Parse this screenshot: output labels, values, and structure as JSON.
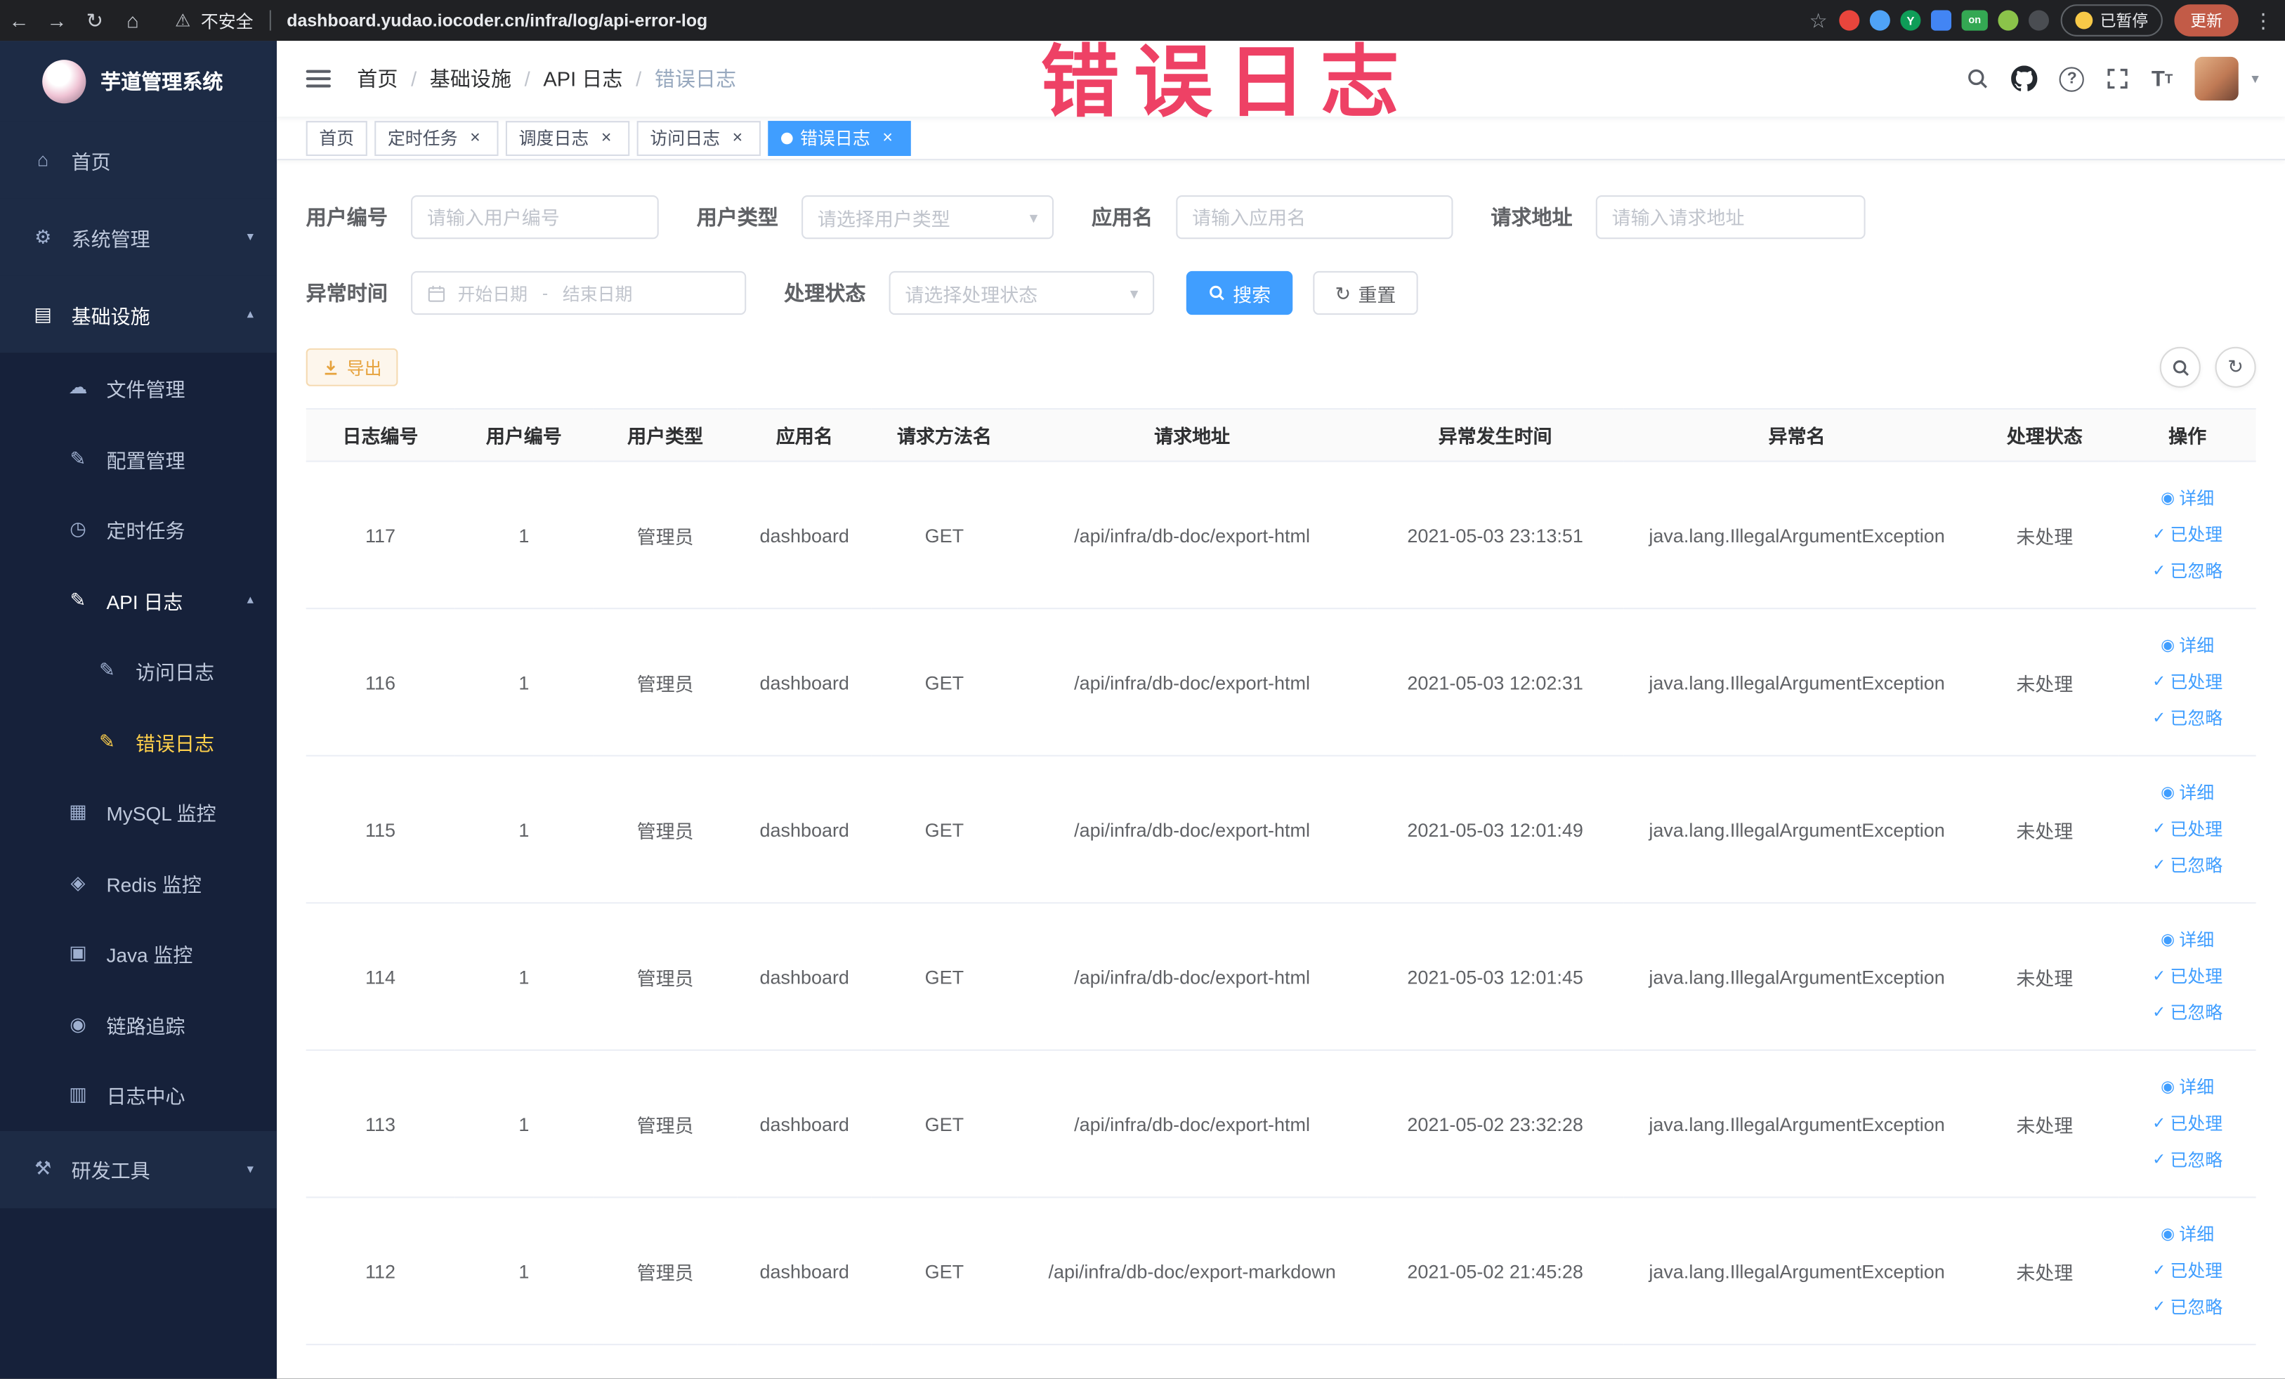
{
  "browser": {
    "security_label": "不安全",
    "url": "dashboard.yudao.iocoder.cn/infra/log/api-error-log",
    "paused_badge": "已暂停",
    "update_button": "更新",
    "extensions": [
      {
        "key": "red-circle",
        "label": ""
      },
      {
        "key": "blue-drop",
        "label": ""
      },
      {
        "key": "green-y",
        "label": "Y"
      },
      {
        "key": "blue-grid",
        "label": ""
      },
      {
        "key": "green-on",
        "label": "on"
      },
      {
        "key": "leaf",
        "label": ""
      },
      {
        "key": "paw",
        "label": ""
      }
    ]
  },
  "annotation": {
    "text": "错误日志"
  },
  "sidebar": {
    "logo_title": "芋道管理系统",
    "items": [
      {
        "key": "home",
        "label": "首页",
        "icon": "home",
        "level": 1
      },
      {
        "key": "system",
        "label": "系统管理",
        "icon": "gear",
        "level": 1,
        "chevron": "down"
      },
      {
        "key": "infra",
        "label": "基础设施",
        "icon": "infra",
        "level": 1,
        "chevron": "up",
        "open": true
      },
      {
        "key": "file",
        "label": "文件管理",
        "icon": "cloud",
        "level": 2
      },
      {
        "key": "config",
        "label": "配置管理",
        "icon": "edit",
        "level": 2
      },
      {
        "key": "job",
        "label": "定时任务",
        "icon": "clock",
        "level": 2
      },
      {
        "key": "api-log",
        "label": "API 日志",
        "icon": "doc",
        "level": 2,
        "chevron": "up",
        "open": true
      },
      {
        "key": "access-log",
        "label": "访问日志",
        "icon": "doc",
        "level": 3
      },
      {
        "key": "error-log",
        "label": "错误日志",
        "icon": "doc",
        "level": 3,
        "active": true
      },
      {
        "key": "mysql",
        "label": "MySQL 监控",
        "icon": "db",
        "level": 2
      },
      {
        "key": "redis",
        "label": "Redis 监控",
        "icon": "redis",
        "level": 2
      },
      {
        "key": "java",
        "label": "Java 监控",
        "icon": "monitor",
        "level": 2
      },
      {
        "key": "trace",
        "label": "链路追踪",
        "icon": "trace",
        "level": 2
      },
      {
        "key": "log-center",
        "label": "日志中心",
        "icon": "logcenter",
        "level": 2
      },
      {
        "key": "dev-tools",
        "label": "研发工具",
        "icon": "tools",
        "level": 1,
        "chevron": "down"
      }
    ]
  },
  "breadcrumb": {
    "items": [
      "首页",
      "基础设施",
      "API 日志",
      "错误日志"
    ]
  },
  "tabs": [
    {
      "key": "home",
      "label": "首页",
      "closable": false,
      "active": false
    },
    {
      "key": "job",
      "label": "定时任务",
      "closable": true,
      "active": false
    },
    {
      "key": "job-log",
      "label": "调度日志",
      "closable": true,
      "active": false
    },
    {
      "key": "access-log",
      "label": "访问日志",
      "closable": true,
      "active": false
    },
    {
      "key": "error-log",
      "label": "错误日志",
      "closable": true,
      "active": true
    }
  ],
  "filters": {
    "user_id": {
      "label": "用户编号",
      "placeholder": "请输入用户编号"
    },
    "user_type": {
      "label": "用户类型",
      "placeholder": "请选择用户类型"
    },
    "app_name": {
      "label": "应用名",
      "placeholder": "请输入应用名"
    },
    "request_url": {
      "label": "请求地址",
      "placeholder": "请输入请求地址"
    },
    "exception_time": {
      "label": "异常时间",
      "start_placeholder": "开始日期",
      "separator": "-",
      "end_placeholder": "结束日期"
    },
    "process_status": {
      "label": "处理状态",
      "placeholder": "请选择处理状态"
    },
    "search_label": "搜索",
    "reset_label": "重置"
  },
  "toolbar": {
    "export_label": "导出"
  },
  "table": {
    "columns": [
      "日志编号",
      "用户编号",
      "用户类型",
      "应用名",
      "请求方法名",
      "请求地址",
      "异常发生时间",
      "异常名",
      "处理状态",
      "操作"
    ],
    "actions": [
      {
        "key": "detail",
        "label": "详细",
        "icon": "eye"
      },
      {
        "key": "processed",
        "label": "已处理",
        "icon": "check"
      },
      {
        "key": "ignored",
        "label": "已忽略",
        "icon": "check"
      }
    ],
    "rows": [
      {
        "id": "117",
        "user_id": "1",
        "user_type": "管理员",
        "app": "dashboard",
        "method": "GET",
        "url": "/api/infra/db-doc/export-html",
        "time": "2021-05-03 23:13:51",
        "exception": "java.lang.IllegalArgumentException",
        "status": "未处理"
      },
      {
        "id": "116",
        "user_id": "1",
        "user_type": "管理员",
        "app": "dashboard",
        "method": "GET",
        "url": "/api/infra/db-doc/export-html",
        "time": "2021-05-03 12:02:31",
        "exception": "java.lang.IllegalArgumentException",
        "status": "未处理"
      },
      {
        "id": "115",
        "user_id": "1",
        "user_type": "管理员",
        "app": "dashboard",
        "method": "GET",
        "url": "/api/infra/db-doc/export-html",
        "time": "2021-05-03 12:01:49",
        "exception": "java.lang.IllegalArgumentException",
        "status": "未处理"
      },
      {
        "id": "114",
        "user_id": "1",
        "user_type": "管理员",
        "app": "dashboard",
        "method": "GET",
        "url": "/api/infra/db-doc/export-html",
        "time": "2021-05-03 12:01:45",
        "exception": "java.lang.IllegalArgumentException",
        "status": "未处理"
      },
      {
        "id": "113",
        "user_id": "1",
        "user_type": "管理员",
        "app": "dashboard",
        "method": "GET",
        "url": "/api/infra/db-doc/export-html",
        "time": "2021-05-02 23:32:28",
        "exception": "java.lang.IllegalArgumentException",
        "status": "未处理"
      },
      {
        "id": "112",
        "user_id": "1",
        "user_type": "管理员",
        "app": "dashboard",
        "method": "GET",
        "url": "/api/infra/db-doc/export-markdown",
        "time": "2021-05-02 21:45:28",
        "exception": "java.lang.IllegalArgumentException",
        "status": "未处理"
      }
    ]
  },
  "icons": {
    "back": "←",
    "forward": "→",
    "reload": "↻",
    "browser_home": "⌂",
    "warning": "⚠",
    "star": "☆",
    "menu_dots": "⋮",
    "chevron_down": "▾",
    "chevron_up": "▴",
    "caret_down": "▾",
    "refresh": "↻",
    "check": "✓",
    "eye": "◉",
    "home": "⌂",
    "gear": "⚙",
    "infra": "▤",
    "cloud": "☁",
    "edit": "✎",
    "clock": "◷",
    "doc": "✎",
    "db": "▦",
    "redis": "◈",
    "monitor": "▣",
    "trace": "◉",
    "logcenter": "▥",
    "tools": "⚒"
  },
  "colors": {
    "accent": "#409eff",
    "active_menu": "#ffd04b",
    "annotation": "#ee4165",
    "warning": "#e6a23c"
  }
}
